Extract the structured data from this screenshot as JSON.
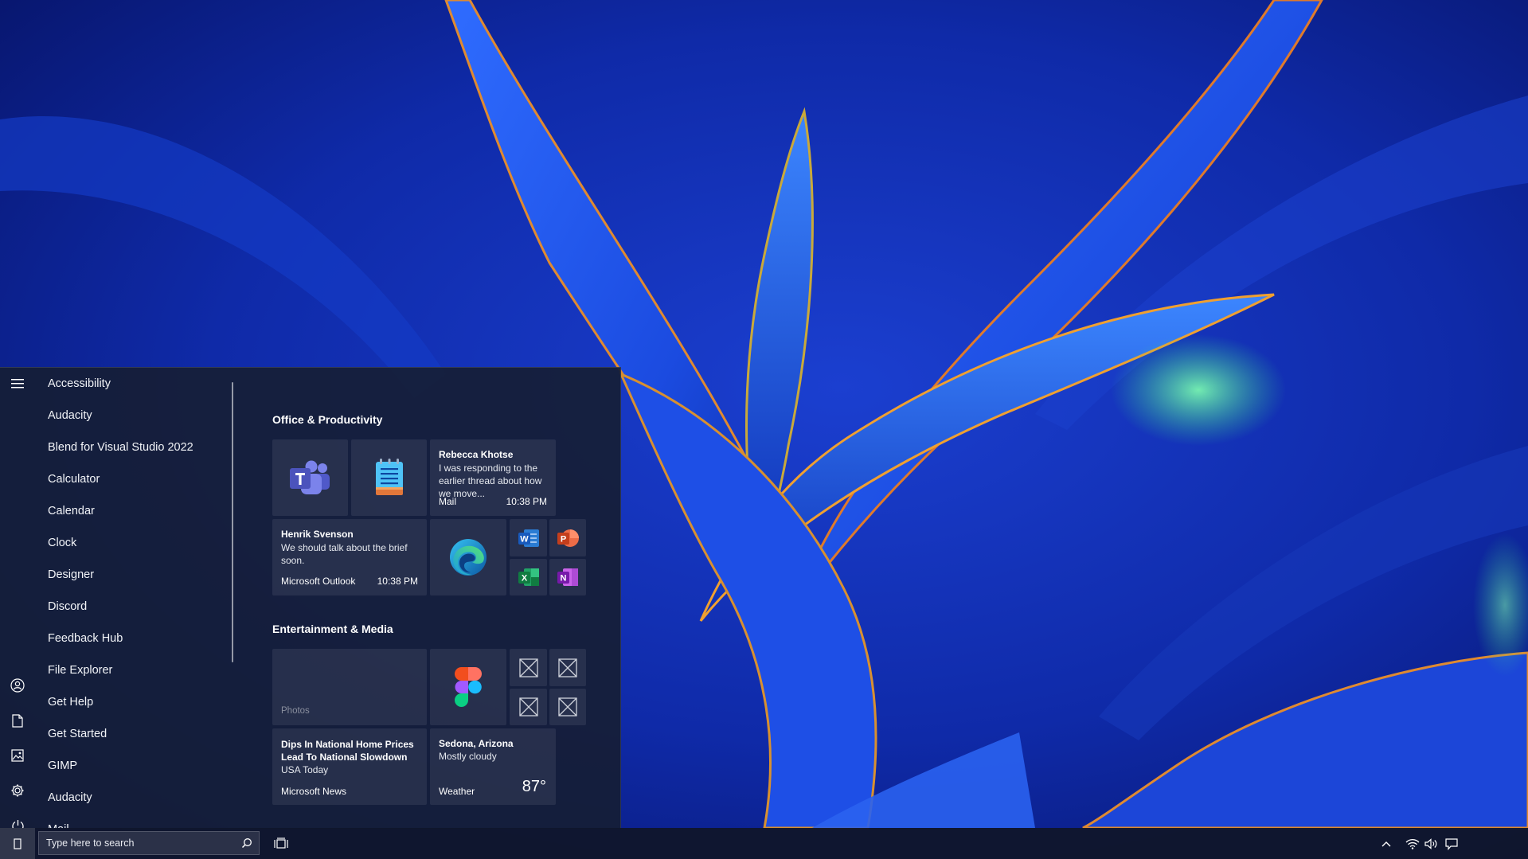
{
  "start_menu": {
    "app_list": [
      "Accessibility",
      "Audacity",
      "Blend for Visual Studio 2022",
      "Calculator",
      "Calendar",
      "Clock",
      "Designer",
      "Discord",
      "Feedback Hub",
      "File Explorer",
      "Get Help",
      "Get Started",
      "GIMP",
      "Audacity",
      "Mail"
    ],
    "rail_icons": [
      "hamburger-menu-icon",
      "user-account-icon",
      "documents-icon",
      "pictures-icon",
      "settings-icon",
      "power-icon"
    ],
    "groups": {
      "office": {
        "title": "Office & Productivity",
        "mail_tile": {
          "sender": "Rebecca Khotse",
          "preview": "I was responding to the earlier thread about how we move...",
          "app": "Mail",
          "time": "10:38 PM"
        },
        "outlook_tile": {
          "sender": "Henrik Svenson",
          "preview": "We should talk about the brief soon.",
          "app": "Microsoft Outlook",
          "time": "10:38 PM"
        }
      },
      "entertainment": {
        "title": "Entertainment & Media",
        "photos_tile": {
          "label": "Photos"
        },
        "news_tile": {
          "headline": "Dips In National Home Prices Lead To National Slowdown",
          "source": "USA Today",
          "app": "Microsoft News"
        },
        "weather_tile": {
          "location": "Sedona, Arizona",
          "condition": "Mostly cloudy",
          "app": "Weather",
          "temperature": "87°"
        }
      }
    }
  },
  "taskbar": {
    "search_placeholder": "Type here to search"
  },
  "colors": {
    "accent_blue": "#1e6fd9",
    "menu_background": "#161e36",
    "taskbar_background": "#10162c"
  }
}
